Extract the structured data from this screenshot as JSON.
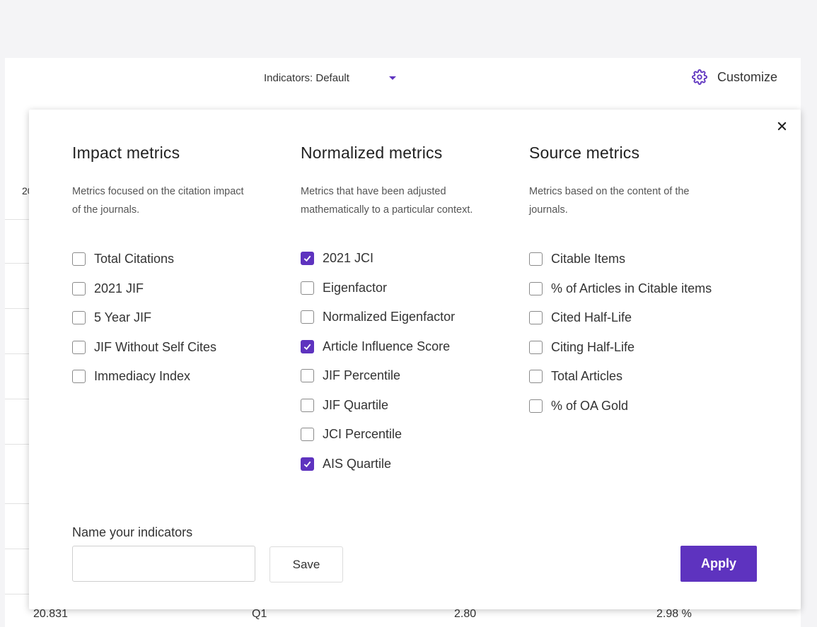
{
  "toolbar": {
    "indicators_label": "Indicators: Default",
    "customize_label": "Customize",
    "accent_color": "#5e33bf"
  },
  "background": {
    "partial_header": "20",
    "bottom_row": [
      "20.831",
      "Q1",
      "2.80",
      "2.98 %"
    ]
  },
  "modal": {
    "columns": [
      {
        "title": "Impact metrics",
        "description": "Metrics focused on the citation impact of the journals.",
        "options": [
          {
            "label": "Total Citations",
            "checked": false
          },
          {
            "label": "2021 JIF",
            "checked": false
          },
          {
            "label": "5 Year JIF",
            "checked": false
          },
          {
            "label": "JIF Without Self Cites",
            "checked": false
          },
          {
            "label": "Immediacy Index",
            "checked": false
          }
        ]
      },
      {
        "title": "Normalized metrics",
        "description": "Metrics that have been adjusted mathematically to a particular context.",
        "options": [
          {
            "label": "2021 JCI",
            "checked": true
          },
          {
            "label": "Eigenfactor",
            "checked": false
          },
          {
            "label": "Normalized Eigenfactor",
            "checked": false
          },
          {
            "label": "Article Influence Score",
            "checked": true
          },
          {
            "label": "JIF Percentile",
            "checked": false
          },
          {
            "label": "JIF Quartile",
            "checked": false
          },
          {
            "label": "JCI Percentile",
            "checked": false
          },
          {
            "label": "AIS Quartile",
            "checked": true
          }
        ]
      },
      {
        "title": "Source metrics",
        "description": "Metrics based on the content of the journals.",
        "options": [
          {
            "label": "Citable Items",
            "checked": false
          },
          {
            "label": "% of Articles in Citable items",
            "checked": false
          },
          {
            "label": "Cited Half-Life",
            "checked": false
          },
          {
            "label": "Citing Half-Life",
            "checked": false
          },
          {
            "label": "Total Articles",
            "checked": false
          },
          {
            "label": "% of OA Gold",
            "checked": false
          }
        ]
      }
    ],
    "name_label": "Name your indicators",
    "name_value": "",
    "save_label": "Save",
    "apply_label": "Apply",
    "close_icon": "close-icon"
  }
}
